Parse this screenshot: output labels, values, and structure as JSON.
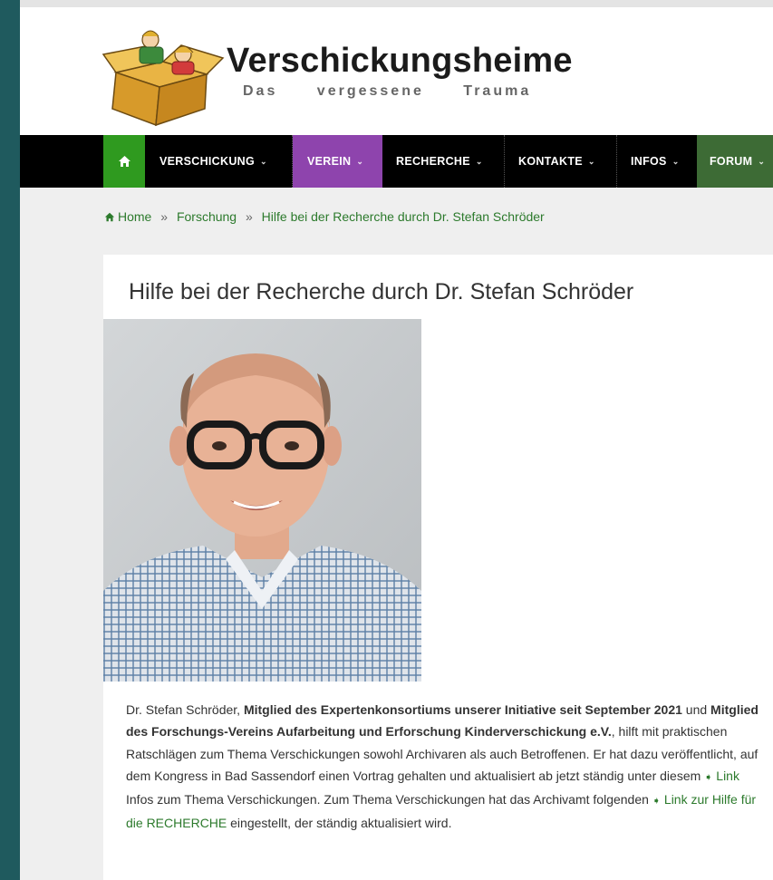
{
  "header": {
    "logo_title": "Verschickungsheime",
    "logo_subtitle": "Das vergessene Trauma"
  },
  "nav": {
    "home_icon": "home-icon",
    "items": [
      {
        "label": "VERSCHICKUNG",
        "bg": "#000000"
      },
      {
        "label": "VEREIN",
        "bg": "#8e44ad"
      },
      {
        "label": "RECHERCHE",
        "bg": "#000000"
      },
      {
        "label": "KONTAKTE",
        "bg": "#000000"
      },
      {
        "label": "INFOS",
        "bg": "#000000"
      },
      {
        "label": "FORUM",
        "bg": "#3d6b35"
      }
    ],
    "chevron": "⌄"
  },
  "breadcrumb": {
    "home": "Home",
    "sep": "»",
    "level1": "Forschung",
    "current": "Hilfe bei der Recherche durch Dr. Stefan Schröder"
  },
  "page": {
    "title": "Hilfe bei der Recherche durch Dr. Stefan Schröder"
  },
  "article": {
    "t1": "Dr. Stefan Schröder, ",
    "b1": "Mitglied des Expertenkonsortiums unserer Initiative seit September 2021",
    "t2": " und ",
    "b2": "Mitglied des Forschungs-Vereins Aufarbeitung und Erforschung Kinderverschickung e.V.",
    "t3": ", hilft mit praktischen Ratschlägen zum Thema Verschickungen sowohl Archivaren als auch Betroffenen. Er hat dazu veröffentlicht, auf dem Kongress in Bad Sassendorf einen Vortrag gehalten und aktualisiert ab jetzt ständig unter diesem ",
    "link1": "Link",
    "t4": " Infos zum Thema Verschickungen. Zum Thema Verschickungen hat das Archivamt folgenden ",
    "link2": "Link zur Hilfe für die RECHERCHE",
    "t5": " eingestellt, der ständig aktualisiert wird.",
    "arrow": "➧"
  },
  "colors": {
    "accent_green": "#2f9a1f",
    "link_green": "#2c7a2c",
    "verein_purple": "#8e44ad",
    "forum_green": "#3d6b35",
    "side_teal": "#1f5a5e"
  }
}
